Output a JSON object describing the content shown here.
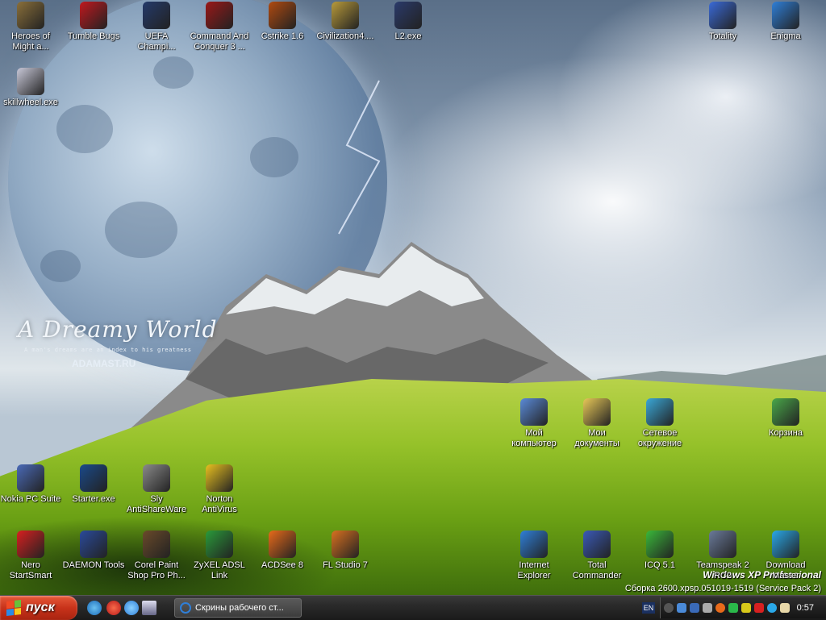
{
  "wallpaper": {
    "title": "A Dreamy World",
    "subtitle": "A man's dreams are an index to his greatness",
    "site": "ADAMAST.RU",
    "watermark_line1": "Windows XP Professional",
    "watermark_line2": "Сборка 2600.xpsp.051019-1519 (Service Pack 2)"
  },
  "icons": [
    {
      "label": "Heroes of\nMight a...",
      "icon": "griffin-icon",
      "color": "#8a6f3a"
    },
    {
      "label": "Tumble Bugs",
      "icon": "bug-icon",
      "color": "#c0181e"
    },
    {
      "label": "UEFA\nChampi...",
      "icon": "football-icon",
      "color": "#243a6a"
    },
    {
      "label": "Command And\nConquer 3 ...",
      "icon": "cnc-icon",
      "color": "#9a1818"
    },
    {
      "label": "Cstrike 1.6",
      "icon": "halflife-icon",
      "color": "#b04a10"
    },
    {
      "label": "Civilization4....",
      "icon": "civ-icon",
      "color": "#b89a3a"
    },
    {
      "label": "L2.exe",
      "icon": "lineage-icon",
      "color": "#2a3a6a"
    },
    {
      "label": "Totality",
      "icon": "text-doc-icon",
      "color": "#3a6ad8"
    },
    {
      "label": "Enigma",
      "icon": "ie-icon",
      "color": "#2f7fd8"
    },
    {
      "label": "skillwheel.exe",
      "icon": "cd-icon",
      "color": "#c8c8d8"
    },
    {
      "label": "Мой\nкомпьютер",
      "icon": "my-computer-icon",
      "color": "#5a8ad8"
    },
    {
      "label": "Мои\nдокументы",
      "icon": "my-documents-icon",
      "color": "#e8c858"
    },
    {
      "label": "Сетевое\nокружение",
      "icon": "network-icon",
      "color": "#3aa8d8"
    },
    {
      "label": "Корзина",
      "icon": "recycle-bin-icon",
      "color": "#4aa84a"
    },
    {
      "label": "Nokia PC Suite",
      "icon": "nokia-icon",
      "color": "#4a6ab8"
    },
    {
      "label": "Starter.exe",
      "icon": "lightning-icon",
      "color": "#1a4a8a"
    },
    {
      "label": "Sly\nAntiShareWare",
      "icon": "sly-icon",
      "color": "#8a8a8a"
    },
    {
      "label": "Norton\nAntiVirus",
      "icon": "norton-icon",
      "color": "#e8c020"
    },
    {
      "label": "Nero\nStartSmart",
      "icon": "nero-icon",
      "color": "#d82020"
    },
    {
      "label": "DAEMON Tools",
      "icon": "daemon-icon",
      "color": "#2a4a9a"
    },
    {
      "label": "Corel Paint\nShop Pro Ph...",
      "icon": "corel-icon",
      "color": "#6a4a2a"
    },
    {
      "label": "ZyXEL ADSL\nLink",
      "icon": "zyxel-icon",
      "color": "#2a9a3a"
    },
    {
      "label": "ACDSee 8",
      "icon": "acdsee-icon",
      "color": "#e86a1a"
    },
    {
      "label": "FL Studio 7",
      "icon": "fl-studio-icon",
      "color": "#d87020"
    },
    {
      "label": "Internet\nExplorer",
      "icon": "ie-icon",
      "color": "#2f7fd8"
    },
    {
      "label": "Total\nCommander",
      "icon": "floppy-icon",
      "color": "#3a5ab8"
    },
    {
      "label": "ICQ 5.1",
      "icon": "icq-icon",
      "color": "#3ab83a"
    },
    {
      "label": "Teamspeak 2\nRC2",
      "icon": "teamspeak-icon",
      "color": "#6a7a9a"
    },
    {
      "label": "Download\nMaster",
      "icon": "download-icon",
      "color": "#2aa8e8"
    }
  ],
  "taskbar": {
    "start_label": "пуск",
    "task_window": "Скрины рабочего ст...",
    "language": "EN",
    "clock": "0:57"
  }
}
